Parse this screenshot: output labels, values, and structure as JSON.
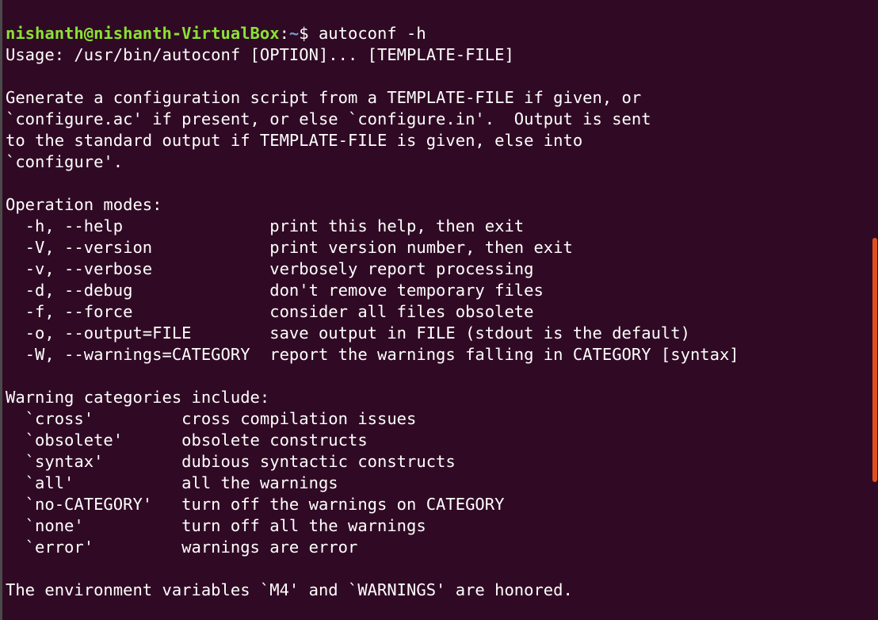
{
  "terminal": {
    "prompt": {
      "user_host": "nishanth@nishanth-VirtualBox",
      "separator": ":",
      "path": "~",
      "symbol": "$ ",
      "command": "autoconf -h"
    },
    "lines": [
      "Usage: /usr/bin/autoconf [OPTION]... [TEMPLATE-FILE]",
      "",
      "Generate a configuration script from a TEMPLATE-FILE if given, or",
      "`configure.ac' if present, or else `configure.in'.  Output is sent",
      "to the standard output if TEMPLATE-FILE is given, else into",
      "`configure'.",
      "",
      "Operation modes:",
      "  -h, --help               print this help, then exit",
      "  -V, --version            print version number, then exit",
      "  -v, --verbose            verbosely report processing",
      "  -d, --debug              don't remove temporary files",
      "  -f, --force              consider all files obsolete",
      "  -o, --output=FILE        save output in FILE (stdout is the default)",
      "  -W, --warnings=CATEGORY  report the warnings falling in CATEGORY [syntax]",
      "",
      "Warning categories include:",
      "  `cross'         cross compilation issues",
      "  `obsolete'      obsolete constructs",
      "  `syntax'        dubious syntactic constructs",
      "  `all'           all the warnings",
      "  `no-CATEGORY'   turn off the warnings on CATEGORY",
      "  `none'          turn off all the warnings",
      "  `error'         warnings are error",
      "",
      "The environment variables `M4' and `WARNINGS' are honored."
    ]
  },
  "colors": {
    "background": "#300a24",
    "text": "#ffffff",
    "prompt_user": "#8ae234",
    "prompt_path": "#729fcf",
    "scrollbar": "#e95420"
  }
}
